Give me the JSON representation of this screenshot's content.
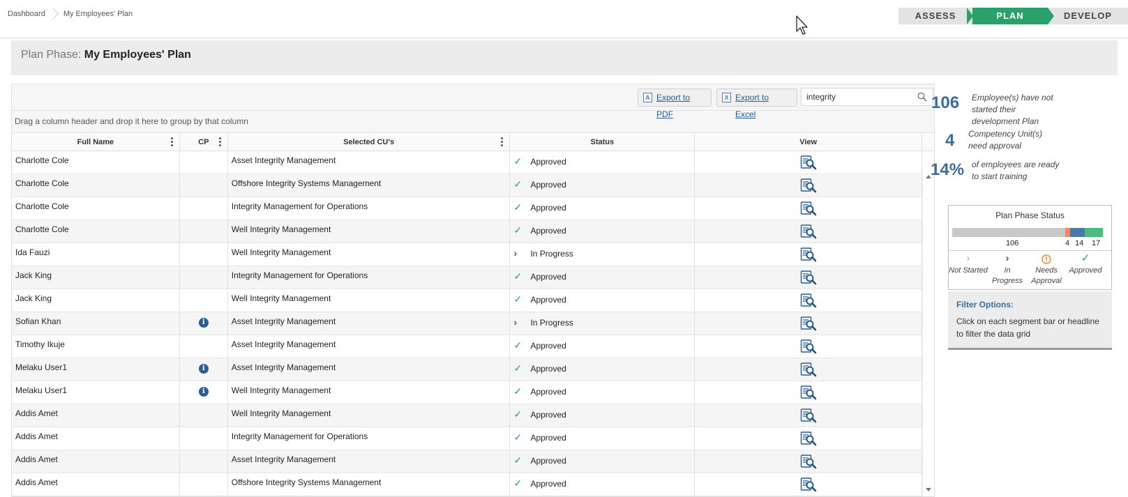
{
  "breadcrumb": {
    "home": "Dashboard",
    "current": "My Employees' Plan"
  },
  "phases": {
    "assess": "ASSESS",
    "plan": "PLAN",
    "develop": "DEVELOP",
    "active": "PLAN"
  },
  "title": {
    "prefix": "Plan Phase:",
    "name": "My Employees' Plan"
  },
  "toolbar": {
    "export_pdf": "Export to PDF",
    "export_excel": "Export to Excel",
    "search_value": "integrity"
  },
  "grid": {
    "group_hint": "Drag a column header and drop it here to group by that column",
    "columns": {
      "name": "Full Name",
      "cp": "CP",
      "cu": "Selected CU's",
      "status": "Status",
      "view": "View"
    },
    "rows": [
      {
        "name": "Charlotte Cole",
        "cp": "",
        "cu": "Asset Integrity Management",
        "status": "Approved"
      },
      {
        "name": "Charlotte Cole",
        "cp": "",
        "cu": "Offshore Integrity Systems Management",
        "status": "Approved"
      },
      {
        "name": "Charlotte Cole",
        "cp": "",
        "cu": "Integrity Management for Operations",
        "status": "Approved"
      },
      {
        "name": "Charlotte Cole",
        "cp": "",
        "cu": "Well Integrity Management",
        "status": "Approved"
      },
      {
        "name": "Ida Fauzi",
        "cp": "",
        "cu": "Well Integrity Management",
        "status": "In Progress"
      },
      {
        "name": "Jack King",
        "cp": "",
        "cu": "Integrity Management for Operations",
        "status": "Approved"
      },
      {
        "name": "Jack King",
        "cp": "",
        "cu": "Well Integrity Management",
        "status": "Approved"
      },
      {
        "name": "Sofian Khan",
        "cp": "info",
        "cu": "Asset Integrity Management",
        "status": "In Progress"
      },
      {
        "name": "Timothy Ikuje",
        "cp": "",
        "cu": "Asset Integrity Management",
        "status": "Approved"
      },
      {
        "name": "Melaku User1",
        "cp": "info",
        "cu": "Asset Integrity Management",
        "status": "Approved"
      },
      {
        "name": "Melaku User1",
        "cp": "info",
        "cu": "Well Integrity Management",
        "status": "Approved"
      },
      {
        "name": "Addis Amet",
        "cp": "",
        "cu": "Well Integrity Management",
        "status": "Approved"
      },
      {
        "name": "Addis Amet",
        "cp": "",
        "cu": "Integrity Management for Operations",
        "status": "Approved"
      },
      {
        "name": "Addis Amet",
        "cp": "",
        "cu": "Asset Integrity Management",
        "status": "Approved"
      },
      {
        "name": "Addis Amet",
        "cp": "",
        "cu": "Offshore Integrity Systems Management",
        "status": "Approved"
      }
    ]
  },
  "stats": {
    "not_started_count": "106",
    "not_started_text": "Employee(s) have not started their development Plan",
    "approval_count": "4",
    "approval_text": "Competency Unit(s) need approval",
    "ready_pct": "14%",
    "ready_text": "of employees are ready to start training"
  },
  "phase_status": {
    "title": "Plan Phase Status",
    "segments": [
      {
        "key": "not_started",
        "value": 106,
        "label": "106",
        "color": "#c8c8c8"
      },
      {
        "key": "needs_approval",
        "value": 4,
        "label": "4",
        "color": "#f08a5d"
      },
      {
        "key": "in_progress",
        "value": 14,
        "label": "14",
        "color": "#4a79a5"
      },
      {
        "key": "approved",
        "value": 17,
        "label": "17",
        "color": "#4cbb7d"
      }
    ],
    "legend": {
      "not_started": "Not Started",
      "in_progress": "In Progress",
      "needs_approval": "Needs Approval",
      "approved": "Approved"
    }
  },
  "filter": {
    "title": "Filter Options:",
    "text": "Click on each segment bar or headline to filter the data grid"
  }
}
